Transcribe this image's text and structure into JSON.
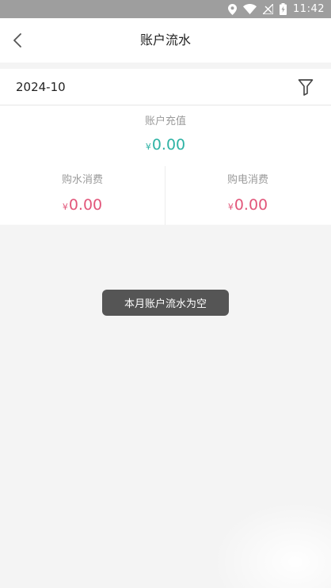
{
  "status_bar": {
    "time": "11:42",
    "icons": [
      "location-icon",
      "wifi-icon",
      "signal-off-icon",
      "battery-charging-icon"
    ]
  },
  "header": {
    "title": "账户流水",
    "back_icon": "chevron-left-icon"
  },
  "filter_row": {
    "month": "2024-10",
    "filter_icon": "funnel-icon"
  },
  "summary": {
    "recharge": {
      "label": "账户充值",
      "currency": "¥",
      "amount": "0.00",
      "color": "#2eb3a5"
    },
    "water": {
      "label": "购水消费",
      "currency": "¥",
      "amount": "0.00",
      "color": "#e2567a"
    },
    "electricity": {
      "label": "购电消费",
      "currency": "¥",
      "amount": "0.00",
      "color": "#e2567a"
    }
  },
  "toast": {
    "message": "本月账户流水为空"
  }
}
